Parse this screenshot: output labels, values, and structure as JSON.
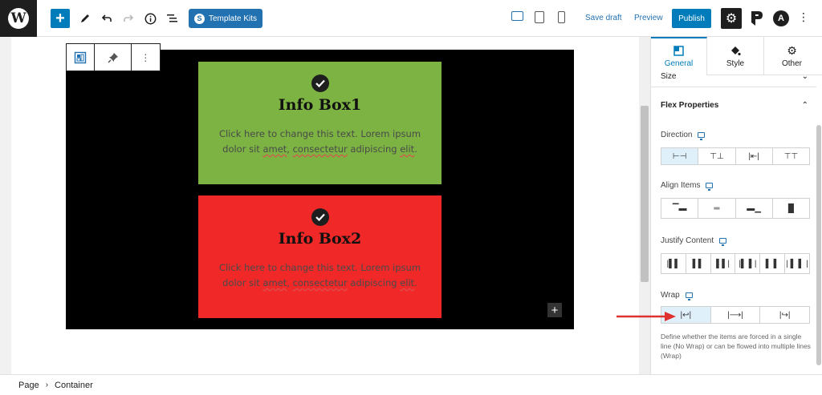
{
  "toolbar": {
    "add_label": "+",
    "template_kits_label": "Template Kits",
    "template_kits_icon": "S",
    "save_draft_label": "Save draft",
    "preview_label": "Preview",
    "publish_label": "Publish",
    "icons": [
      "wordpress-logo",
      "add",
      "pencil",
      "undo",
      "redo",
      "info",
      "list-view",
      "desktop",
      "tablet",
      "mobile",
      "settings",
      "plugin-p",
      "plugin-a",
      "more-vertical"
    ]
  },
  "canvas": {
    "info_boxes": [
      {
        "title": "Info Box1",
        "text_parts": [
          "Click here to change this text. Lorem ipsum dolor sit ",
          "amet",
          ", ",
          "consectetur",
          " adipiscing ",
          "elit",
          "."
        ],
        "background": "#7cb342"
      },
      {
        "title": "Info Box2",
        "text_parts": [
          "Click here to change this text. Lorem ipsum dolor sit ",
          "amet",
          ", ",
          "consectetur",
          " adipiscing ",
          "elit",
          "."
        ],
        "background": "#f02828"
      }
    ],
    "container_background": "#000000"
  },
  "sidebar": {
    "tabs": [
      {
        "label": "General",
        "active": true,
        "icon": "layout-icon"
      },
      {
        "label": "Style",
        "active": false,
        "icon": "paint-bucket-icon"
      },
      {
        "label": "Other",
        "active": false,
        "icon": "gear-icon"
      }
    ],
    "size_label": "Size",
    "flex_properties_label": "Flex Properties",
    "direction_label": "Direction",
    "align_items_label": "Align Items",
    "justify_content_label": "Justify Content",
    "wrap_label": "Wrap",
    "wrap_help": "Define whether the items are forced in a single line (No Wrap) or can be flowed into multiple lines (Wrap)",
    "direction_options": [
      "row",
      "column",
      "row-reverse",
      "column-reverse"
    ],
    "align_options": [
      "flex-start",
      "center",
      "flex-end",
      "stretch"
    ],
    "justify_options": [
      "flex-start",
      "center",
      "flex-end",
      "space-between",
      "space-around",
      "space-evenly"
    ],
    "wrap_options": [
      "wrap",
      "nowrap",
      "wrap-reverse"
    ],
    "selected": {
      "direction": 0,
      "wrap": 0
    }
  },
  "breadcrumb": {
    "items": [
      "Page",
      "Container"
    ]
  },
  "colors": {
    "accent": "#007cba",
    "arrow": "#e03131"
  }
}
